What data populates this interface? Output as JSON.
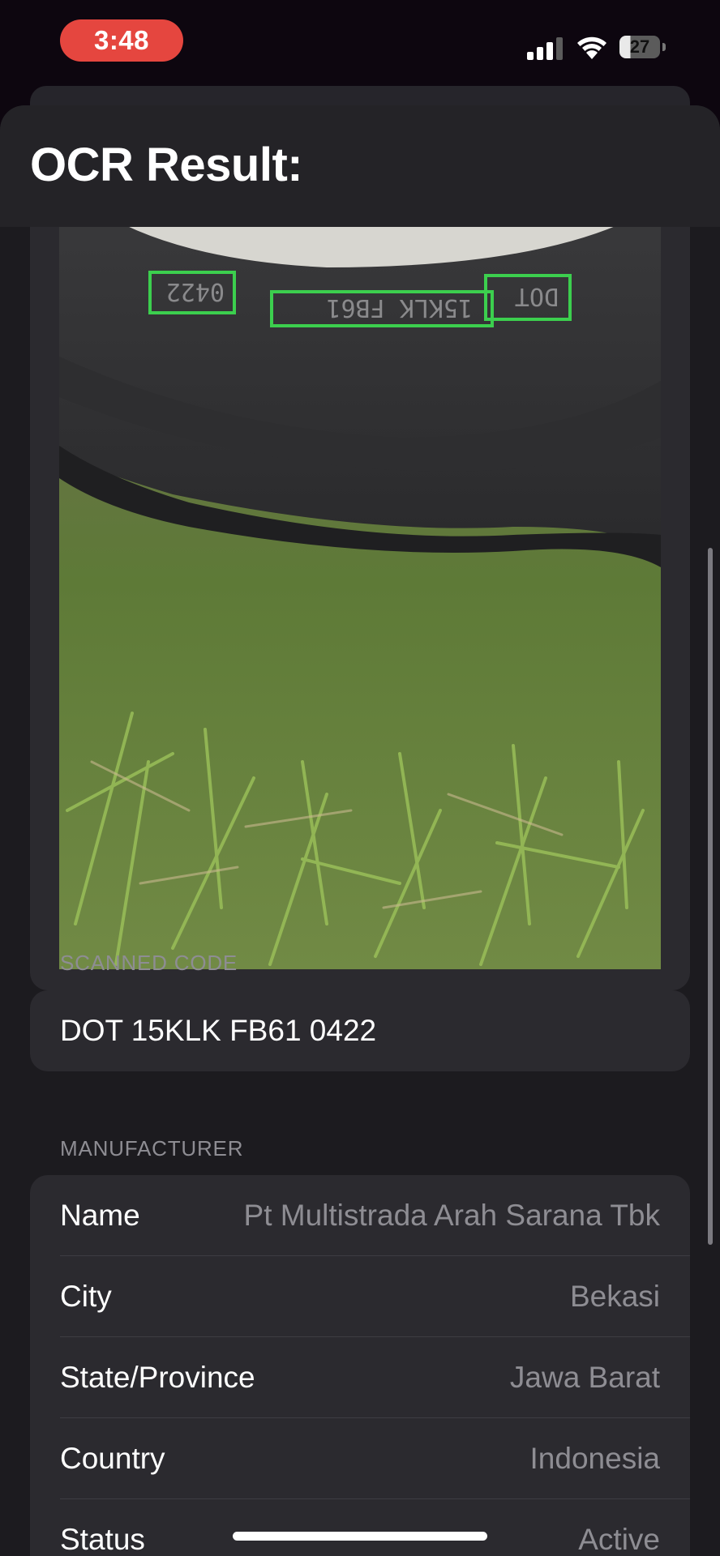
{
  "status_bar": {
    "time": "3:48",
    "battery": "27",
    "icons": [
      "cellular-signal-icon",
      "wifi-icon",
      "battery-icon"
    ]
  },
  "sheet": {
    "title": "OCR Result:"
  },
  "image": {
    "description_icon": "tire-sidewall-photo",
    "detection_box_color": "#3ccf4e",
    "detected_text_regions": [
      "0422",
      "15KLK FB61",
      "DOT"
    ]
  },
  "scanned_code": {
    "header": "SCANNED CODE",
    "value": "DOT 15KLK FB61 0422"
  },
  "manufacturer": {
    "header": "MANUFACTURER",
    "rows": [
      {
        "label": "Name",
        "value": "Pt Multistrada Arah Sarana Tbk"
      },
      {
        "label": "City",
        "value": "Bekasi"
      },
      {
        "label": "State/Province",
        "value": "Jawa Barat"
      },
      {
        "label": "Country",
        "value": "Indonesia"
      },
      {
        "label": "Status",
        "value": "Active"
      }
    ]
  },
  "colors": {
    "background": "#0d060f",
    "sheet": "#1c1b1f",
    "card": "#2b2a2f",
    "time_pill": "#e5463f",
    "secondary_text": "#8e8d93"
  }
}
